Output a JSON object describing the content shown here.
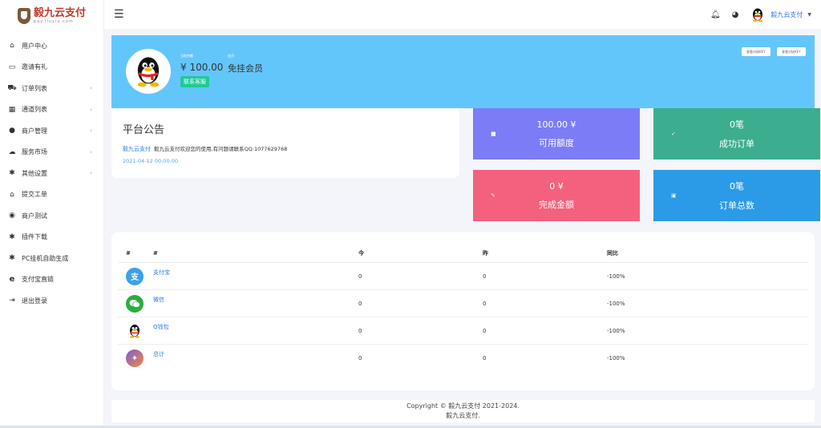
{
  "logo": {
    "main": "毅九云支付",
    "sub": "pay.lluyiu.com"
  },
  "sidebar": {
    "items": [
      {
        "label": "用户中心",
        "icon": "home-icon",
        "caret": false
      },
      {
        "label": "邀请有礼",
        "icon": "monitor-icon",
        "caret": false
      },
      {
        "label": "订单列表",
        "icon": "cart-icon",
        "caret": true
      },
      {
        "label": "通道列表",
        "icon": "grid-icon",
        "caret": true
      },
      {
        "label": "商户管理",
        "icon": "user-icon",
        "caret": true
      },
      {
        "label": "服务市场",
        "icon": "cloud-icon",
        "caret": true
      },
      {
        "label": "其他设置",
        "icon": "gear-icon",
        "caret": true
      },
      {
        "label": "提交工单",
        "icon": "home-outline-icon",
        "caret": false
      },
      {
        "label": "商户测试",
        "icon": "compass-icon",
        "caret": false
      },
      {
        "label": "插件下载",
        "icon": "gear-icon",
        "caret": false
      },
      {
        "label": "PC挂机自助生成",
        "icon": "gear-icon",
        "caret": false
      },
      {
        "label": "支付宝直链",
        "icon": "e-icon",
        "caret": false
      },
      {
        "label": "退出登录",
        "icon": "logout-icon",
        "caret": false
      }
    ]
  },
  "topbar": {
    "user_name": "毅九云支付"
  },
  "banner": {
    "balance_label": "当前余额",
    "balance": "¥ 100.00",
    "member_label": "会员",
    "member": "免挂会员",
    "contact_btn": "联系客服",
    "btn_left": "查看对接KEY",
    "btn_right": "查看对接KEY"
  },
  "notice": {
    "title": "平台公告",
    "brand": "毅九云支付",
    "text": "毅九云支付欢迎您的使用,有问题请联系QQ:1077629768",
    "date": "2021-04-12 00:00:00"
  },
  "tiles": [
    {
      "value": "100.00 ¥",
      "label": "可用额度",
      "color": "#7c7cf7"
    },
    {
      "value": "0笔",
      "label": "成功订单",
      "color": "#3cad8f"
    },
    {
      "value": "0 ¥",
      "label": "完成金额",
      "color": "#f4617e"
    },
    {
      "value": "0笔",
      "label": "订单总数",
      "color": "#2b9ae7"
    }
  ],
  "table": {
    "headers": [
      "#",
      "#",
      "今",
      "昨",
      "同比"
    ],
    "rows": [
      {
        "icon": "alipay-icon",
        "name": "支付宝",
        "today": "0",
        "yesterday": "0",
        "ratio": "-100%",
        "color": "#3aa3e8"
      },
      {
        "icon": "wechat-icon",
        "name": "微信",
        "today": "0",
        "yesterday": "0",
        "ratio": "-100%",
        "color": "#2aae3f"
      },
      {
        "icon": "qq-icon",
        "name": "Q钱包",
        "today": "0",
        "yesterday": "0",
        "ratio": "-100%",
        "color": "#1a1a1a"
      },
      {
        "icon": "total-icon",
        "name": "总计",
        "today": "0",
        "yesterday": "0",
        "ratio": "-100%",
        "color": "#8a55c8"
      }
    ]
  },
  "footer": {
    "line1": "Copyright © 毅九云支付 2021-2024.",
    "line2": "毅九云支付."
  }
}
